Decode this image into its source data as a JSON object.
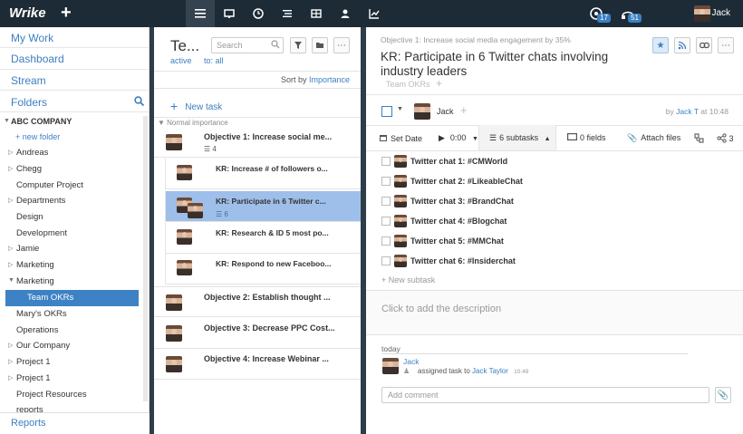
{
  "topbar": {
    "logo": "Wrike",
    "new_button": "+",
    "nav_icons": [
      "menu-icon",
      "monitor-icon",
      "clock-icon",
      "list-icon",
      "table-icon",
      "person-icon",
      "chart-icon"
    ],
    "notifications_count": "17",
    "inbox_count": "51",
    "user_name": "Jack"
  },
  "sidebar": {
    "links": [
      "My Work",
      "Dashboard",
      "Stream",
      "Folders"
    ],
    "company": "ABC COMPANY",
    "new_folder": "+ new folder",
    "items": [
      {
        "label": "Andreas",
        "arrow": "right"
      },
      {
        "label": "Chegg",
        "arrow": "right"
      },
      {
        "label": "Computer Project",
        "arrow": ""
      },
      {
        "label": "Departments",
        "arrow": "right"
      },
      {
        "label": "Design",
        "arrow": ""
      },
      {
        "label": "Development",
        "arrow": ""
      },
      {
        "label": "Jamie",
        "arrow": "right"
      },
      {
        "label": "Marketing",
        "arrow": "right"
      },
      {
        "label": "Marketing",
        "arrow": "down"
      },
      {
        "label": "Team OKRs",
        "arrow": ""
      },
      {
        "label": "Mary's OKRs",
        "arrow": ""
      },
      {
        "label": "Operations",
        "arrow": ""
      },
      {
        "label": "Our Company",
        "arrow": "right"
      },
      {
        "label": "Project 1",
        "arrow": "right"
      },
      {
        "label": "Project 1",
        "arrow": "right"
      },
      {
        "label": "Project Resources",
        "arrow": ""
      },
      {
        "label": "reports",
        "arrow": ""
      }
    ],
    "active_item": "Team OKRs",
    "reports": "Reports"
  },
  "middle": {
    "title": "Te...",
    "search_placeholder": "Search",
    "filter_active": "active",
    "filter_to": "to: all",
    "sort_label": "Sort by",
    "sort_value": "Importance",
    "new_task": "New task",
    "group_header": "Normal importance",
    "tasks": [
      {
        "name": "Objective 1: Increase social me...",
        "subtasks": "4"
      },
      {
        "name": "KR: Increase # of followers o...",
        "sub": true
      },
      {
        "name": "KR: Participate in 6 Twitter c...",
        "sub": true,
        "selected": true,
        "subtasks": "6"
      },
      {
        "name": "KR: Research & ID 5 most po...",
        "sub": true
      },
      {
        "name": "KR: Respond to new Faceboo...",
        "sub": true
      },
      {
        "name": "Objective 2: Establish thought ..."
      },
      {
        "name": "Objective 3: Decrease PPC Cost..."
      },
      {
        "name": "Objective 4: Increase Webinar ..."
      }
    ]
  },
  "right": {
    "breadcrumb": "Objective 1: Increase social media engagement by 35%",
    "title": "KR: Participate in 6 Twitter chats involving industry leaders",
    "tag": "Team OKRs",
    "assignee": "Jack",
    "by_prefix": "by",
    "by_user": "Jack T",
    "by_time": "at 10:48",
    "toolbar": {
      "set_date": "Set Date",
      "timer": "0:00",
      "subtasks": "6 subtasks",
      "fields": "0 fields",
      "attach": "Attach files",
      "deps": "3"
    },
    "subtasks": [
      "Twitter chat 1: #CMWorld",
      "Twitter chat 2: #LikeableChat",
      "Twitter chat 3: #BrandChat",
      "Twitter chat 4: #Blogchat",
      "Twitter chat 5: #MMChat",
      "Twitter chat 6: #Insiderchat"
    ],
    "new_subtask": "+ New subtask",
    "description_placeholder": "Click to add the description",
    "activity_day": "today",
    "activity_user": "Jack",
    "activity_text": "assigned task to",
    "activity_target": "Jack Taylor",
    "activity_time": "10:49",
    "comment_placeholder": "Add comment"
  }
}
